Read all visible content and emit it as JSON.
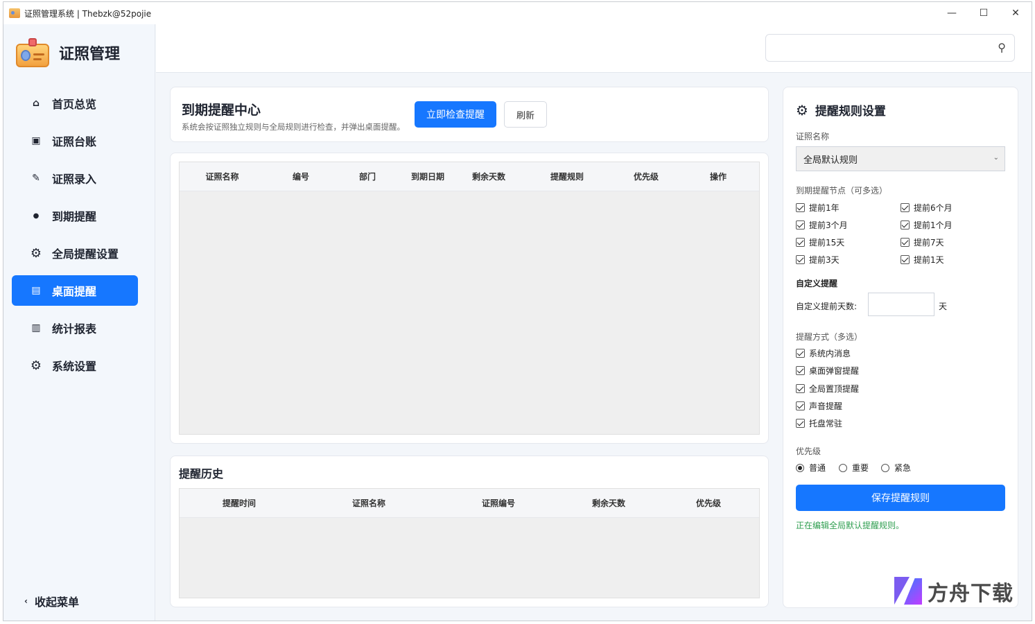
{
  "window": {
    "title": "证照管理系统 | Thebzk@52pojie",
    "controls": {
      "minimize": "—",
      "maximize": "☐",
      "close": "✕"
    }
  },
  "sidebar": {
    "brand": "证照管理",
    "items": [
      {
        "label": "首页总览",
        "icon": "home-icon",
        "glyph": "⌂",
        "active": false
      },
      {
        "label": "证照台账",
        "icon": "ledger-icon",
        "glyph": "▣",
        "active": false
      },
      {
        "label": "证照录入",
        "icon": "pen-icon",
        "glyph": "✎",
        "active": false
      },
      {
        "label": "到期提醒",
        "icon": "dot-icon",
        "glyph": "●",
        "active": false
      },
      {
        "label": "全局提醒设置",
        "icon": "gear-icon",
        "glyph": "⚙",
        "active": false
      },
      {
        "label": "桌面提醒",
        "icon": "list-icon",
        "glyph": "▤",
        "active": true
      },
      {
        "label": "统计报表",
        "icon": "chart-icon",
        "glyph": "▥",
        "active": false
      },
      {
        "label": "系统设置",
        "icon": "gear-icon",
        "glyph": "⚙",
        "active": false
      }
    ],
    "collapse": {
      "label": "收起菜单",
      "glyph": "‹"
    }
  },
  "header": {
    "search_value": "",
    "search_icon": "⚲"
  },
  "reminder_center": {
    "title": "到期提醒中心",
    "desc": "系统会按证照独立规则与全局规则进行检查，并弹出桌面提醒。",
    "check_button": "立即检查提醒",
    "refresh_button": "刷新",
    "columns": [
      "证照名称",
      "编号",
      "部门",
      "到期日期",
      "剩余天数",
      "提醒规则",
      "优先级",
      "操作"
    ]
  },
  "history": {
    "title": "提醒历史",
    "columns": [
      "提醒时间",
      "证照名称",
      "证照编号",
      "剩余天数",
      "优先级"
    ]
  },
  "rules": {
    "title": "提醒规则设置",
    "cert_label": "证照名称",
    "cert_select": "全局默认规则",
    "nodes_label": "到期提醒节点（可多选）",
    "nodes": [
      "提前1年",
      "提前6个月",
      "提前3个月",
      "提前1个月",
      "提前15天",
      "提前7天",
      "提前3天",
      "提前1天"
    ],
    "custom_title": "自定义提醒",
    "custom_label": "自定义提前天数:",
    "custom_value": "",
    "custom_unit": "天",
    "methods_label": "提醒方式（多选）",
    "methods": [
      "系统内消息",
      "桌面弹窗提醒",
      "全局置顶提醒",
      "声音提醒",
      "托盘常驻"
    ],
    "priority_label": "优先级",
    "priorities": [
      "普通",
      "重要",
      "紧急"
    ],
    "priority_selected": "普通",
    "save_button": "保存提醒规则",
    "status": "正在编辑全局默认提醒规则。"
  },
  "watermark": {
    "text": "方舟下载"
  }
}
